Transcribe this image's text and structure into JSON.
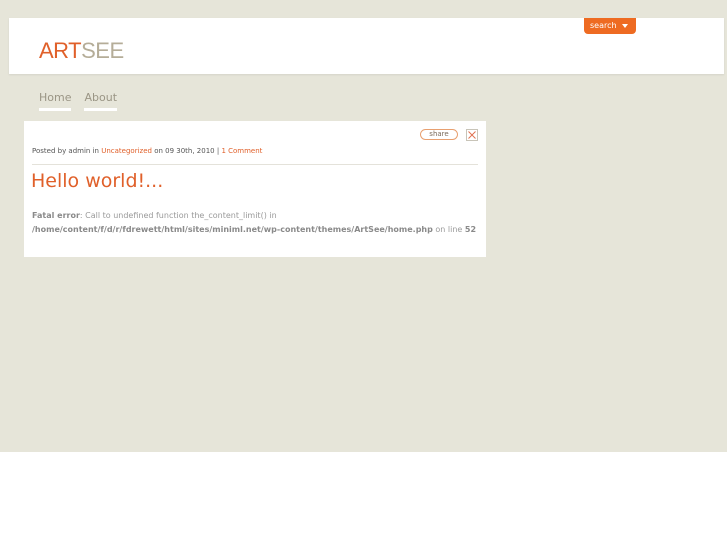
{
  "header": {
    "logo_part1": "ART",
    "logo_part2": "SEE",
    "search_label": "search"
  },
  "nav": {
    "items": [
      {
        "label": "Home"
      },
      {
        "label": "About"
      }
    ]
  },
  "post": {
    "share_label": "share",
    "meta": {
      "prefix": "Posted by admin in",
      "category": "Uncategorized",
      "date_text": "on 09 30th, 2010 |",
      "comments": "1 Comment"
    },
    "title": "Hello world!...",
    "error": {
      "label": "Fatal error",
      "message": ": Call to undefined function the_content_limit() in",
      "path": "/home/content/f/d/r/fdrewett/html/sites/miniml.net/wp-content/themes/ArtSee/home.php",
      "on_line": "on line",
      "line_number": "52"
    }
  },
  "colors": {
    "accent": "#e0602a",
    "background": "#e6e5d9",
    "search_tab": "#ee6b22"
  }
}
